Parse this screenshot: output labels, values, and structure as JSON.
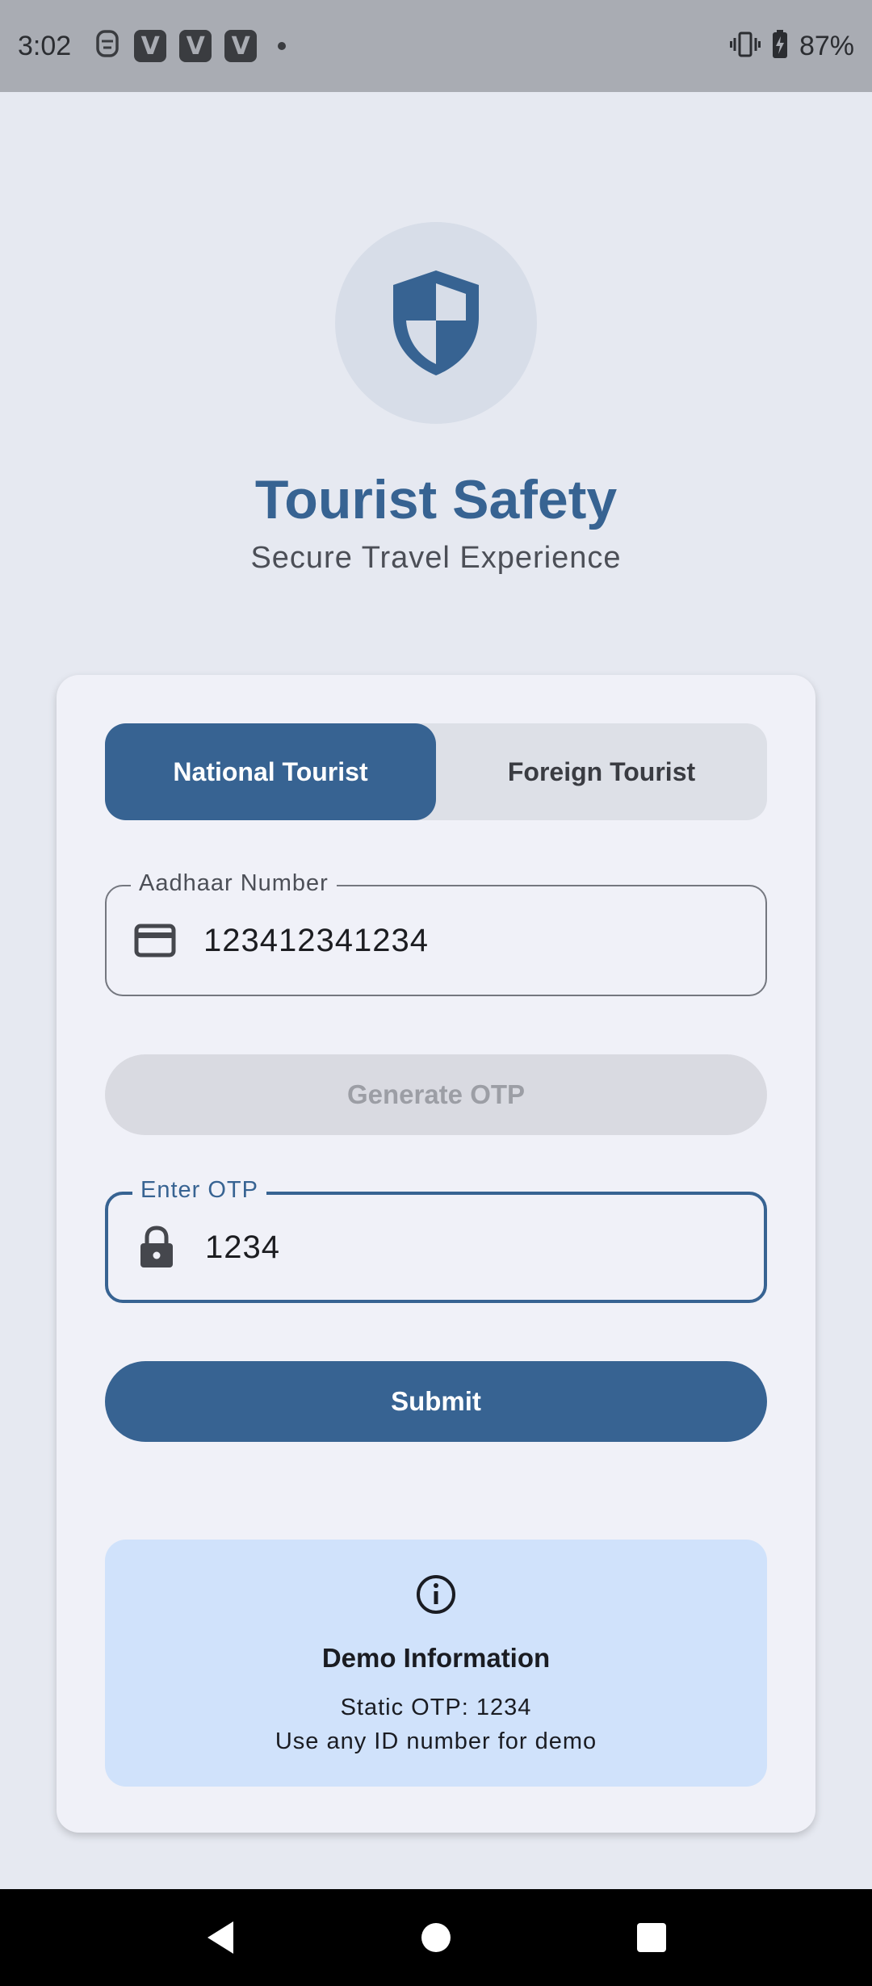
{
  "status_bar": {
    "time": "3:02",
    "notifications": [
      "V",
      "V",
      "V"
    ],
    "battery": "87%"
  },
  "header": {
    "title": "Tourist Safety",
    "subtitle": "Secure Travel Experience"
  },
  "toggle": {
    "options": [
      "National Tourist",
      "Foreign Tourist"
    ],
    "selected": "National Tourist"
  },
  "form": {
    "id_field": {
      "label": "Aadhaar Number",
      "value": "123412341234",
      "icon": "credit-card-icon"
    },
    "generate_button": "Generate OTP",
    "otp_field": {
      "label": "Enter OTP",
      "value": "1234",
      "icon": "lock-icon"
    },
    "submit_button": "Submit"
  },
  "info": {
    "icon": "info-icon",
    "title": "Demo Information",
    "line1": "Static OTP: 1234",
    "line2": "Use any ID number for demo"
  },
  "colors": {
    "primary": "#376392",
    "background": "#e6e9f1",
    "card": "#f0f1f8",
    "info_bg": "#d0e2fb"
  }
}
